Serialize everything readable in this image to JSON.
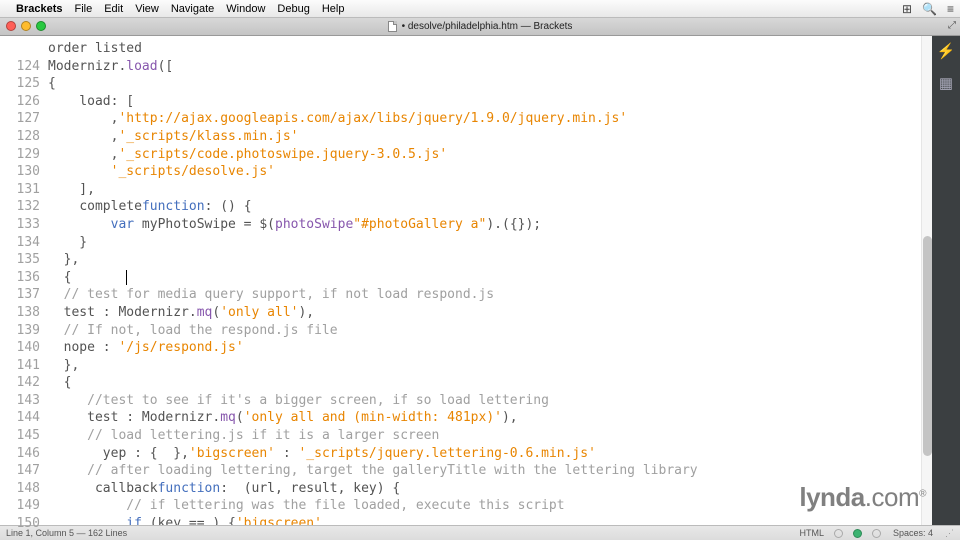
{
  "menubar": {
    "app": "Brackets",
    "items": [
      "File",
      "Edit",
      "View",
      "Navigate",
      "Window",
      "Debug",
      "Help"
    ]
  },
  "tab": {
    "title": "• desolve/philadelphia.htm — Brackets"
  },
  "gutter": {
    "start": 124,
    "end": 150
  },
  "code": {
    "partial_top": "order listed",
    "lines": {
      "124": {
        "pre": "Modernizr.",
        "fn": "load",
        "post": "(["
      },
      "125": "{",
      "126": {
        "prop": "    load",
        "post": ": ["
      },
      "127": {
        "indent": "        ",
        "str": "'http://ajax.googleapis.com/ajax/libs/jquery/1.9.0/jquery.min.js'",
        "post": ","
      },
      "128": {
        "indent": "        ",
        "str": "'_scripts/klass.min.js'",
        "post": ","
      },
      "129": {
        "indent": "        ",
        "str": "'_scripts/code.photoswipe.jquery-3.0.5.js'",
        "post": ","
      },
      "130": {
        "indent": "        ",
        "str": "'_scripts/desolve.js'"
      },
      "131": "    ],",
      "132": {
        "indent": "    ",
        "prop": "complete",
        "mid": ": ",
        "kw": "function",
        "post": "() {"
      },
      "133": {
        "indent": "        ",
        "kw": "var",
        "mid": " myPhotoSwipe = $(",
        "str": "\"#photoGallery a\"",
        "post2": ").",
        "fn": "photoSwipe",
        "post3": "({});"
      },
      "134": "    }",
      "135": "  },",
      "136": "  {",
      "137": {
        "indent": "  ",
        "cm": "// test for media query support, if not load respond.js"
      },
      "138": {
        "indent": "  ",
        "prop": "test",
        "mid": " : Modernizr.",
        "fn": "mq",
        "post": "(",
        "str": "'only all'",
        "post2": "),"
      },
      "139": {
        "indent": "  ",
        "cm": "// If not, load the respond.js file"
      },
      "140": {
        "indent": "  ",
        "prop": "nope",
        "mid": " : ",
        "str": "'/js/respond.js'"
      },
      "141": "  },",
      "142": "  {",
      "143": {
        "indent": "     ",
        "cm": "//test to see if it's a bigger screen, if so load lettering"
      },
      "144": {
        "indent": "     ",
        "prop": "test",
        "mid": " : Modernizr.",
        "fn": "mq",
        "post": "(",
        "str": "'only all and (min-width: 481px)'",
        "post2": "),"
      },
      "145": {
        "indent": "     ",
        "cm": "// load lettering.js if it is a larger screen"
      },
      "146": {
        "indent": "       ",
        "prop": "yep",
        "mid": " : { ",
        "str": "'bigscreen'",
        "mid2": " : ",
        "str2": "'_scripts/jquery.lettering-0.6.min.js'",
        "post": " },"
      },
      "147": {
        "indent": "     ",
        "cm": "// after loading lettering, target the galleryTitle with the lettering library"
      },
      "148": {
        "indent": "      ",
        "prop": "callback",
        "mid": ": ",
        "kw": "function",
        "post": " (url, result, key) {"
      },
      "149": {
        "indent": "          ",
        "cm": "// if lettering was the file loaded, execute this script"
      },
      "150": {
        "indent": "          ",
        "kw": "if",
        "mid": " (key == ",
        "str": "'bigscreen'",
        "post": ") {"
      }
    }
  },
  "status": {
    "left": "Line 1, Column 5 — 162 Lines",
    "lang": "HTML",
    "spaces": "Spaces: 4"
  },
  "watermark": "lynda.com"
}
